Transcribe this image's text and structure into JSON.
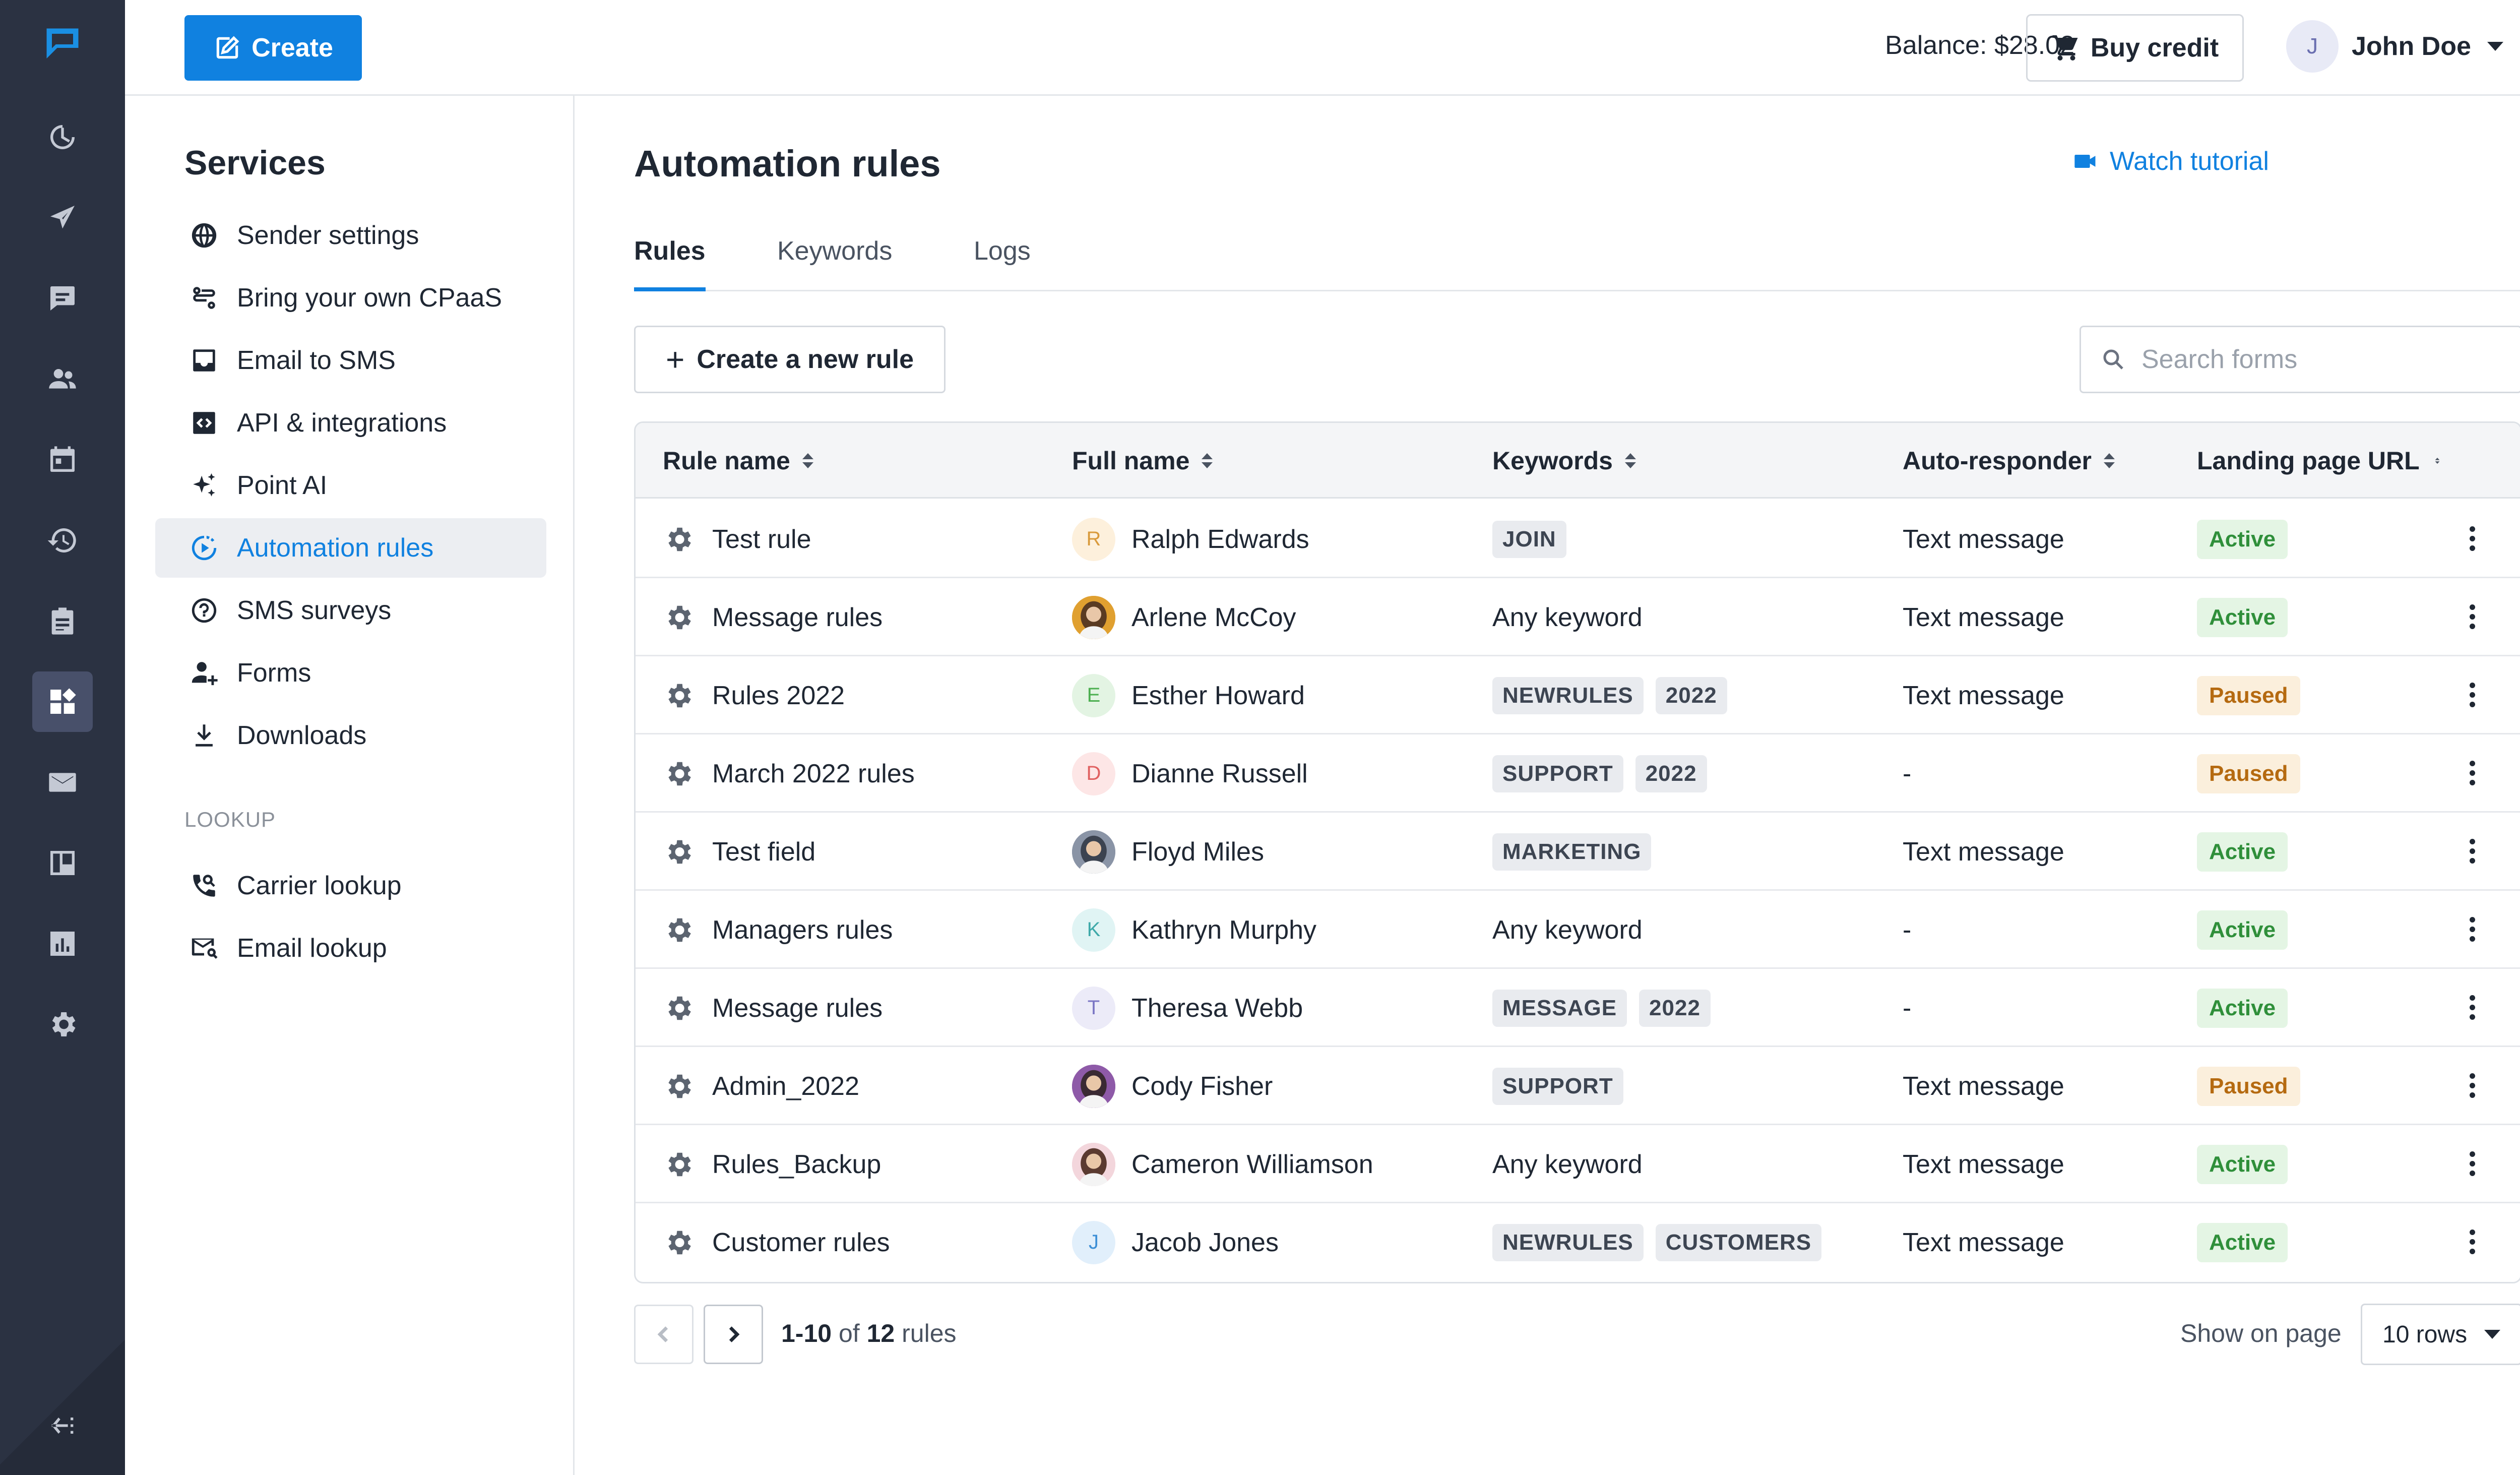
{
  "topbar": {
    "create_label": "Create",
    "balance": "Balance: $28.02",
    "buy_credit_label": "Buy credit",
    "user_initial": "J",
    "user_name": "John Doe"
  },
  "rail": {
    "icons": [
      "logo-icon",
      "dashboard-icon",
      "send-icon",
      "chat-icon",
      "contacts-icon",
      "calendar-icon",
      "history-icon",
      "clipboard-icon",
      "services-icon",
      "mail-icon",
      "board-icon",
      "analytics-icon",
      "settings-icon",
      "collapse-icon"
    ],
    "active": "services-icon"
  },
  "services": {
    "title": "Services",
    "items": [
      {
        "label": "Sender settings",
        "icon": "globe-icon"
      },
      {
        "label": "Bring your own CPaaS",
        "icon": "route-icon"
      },
      {
        "label": "Email to SMS",
        "icon": "inbox-icon"
      },
      {
        "label": "API & integrations",
        "icon": "code-icon"
      },
      {
        "label": "Point AI",
        "icon": "sparkle-icon"
      },
      {
        "label": "Automation rules",
        "icon": "automation-icon",
        "active": true
      },
      {
        "label": "SMS surveys",
        "icon": "question-icon"
      },
      {
        "label": "Forms",
        "icon": "person-add-icon"
      },
      {
        "label": "Downloads",
        "icon": "download-icon"
      }
    ],
    "lookup_heading": "LOOKUP",
    "lookup_items": [
      {
        "label": "Carrier lookup",
        "icon": "phone-search-icon"
      },
      {
        "label": "Email lookup",
        "icon": "mail-search-icon"
      }
    ]
  },
  "main": {
    "title": "Automation rules",
    "watch_tutorial": "Watch tutorial",
    "tabs": [
      {
        "label": "Rules",
        "active": true
      },
      {
        "label": "Keywords"
      },
      {
        "label": "Logs"
      }
    ],
    "create_rule_label": "Create a new rule",
    "search_placeholder": "Search forms"
  },
  "table": {
    "columns": [
      "Rule name",
      "Full name",
      "Keywords",
      "Auto-responder",
      "Landing page URL"
    ],
    "rows": [
      {
        "rule": "Test rule",
        "name": "Ralph Edwards",
        "avatar": {
          "initial": "R",
          "bg": "#fdf0dc",
          "fg": "#d99a3c"
        },
        "keywords": [
          "JOIN"
        ],
        "any_keyword": "",
        "responder": "Text message",
        "status": "Active"
      },
      {
        "rule": "Message rules",
        "name": "Arlene McCoy",
        "avatar": {
          "photo": true,
          "bg": "#e0a030",
          "fg": "#5a3b22"
        },
        "keywords": [],
        "any_keyword": "Any keyword",
        "responder": "Text message",
        "status": "Active"
      },
      {
        "rule": "Rules 2022",
        "name": "Esther Howard",
        "avatar": {
          "initial": "E",
          "bg": "#e3f4e3",
          "fg": "#4caf50"
        },
        "keywords": [
          "NEWRULES",
          "2022"
        ],
        "any_keyword": "",
        "responder": "Text message",
        "status": "Paused"
      },
      {
        "rule": "March 2022 rules",
        "name": "Dianne Russell",
        "avatar": {
          "initial": "D",
          "bg": "#fde6e6",
          "fg": "#e06060"
        },
        "keywords": [
          "SUPPORT",
          "2022"
        ],
        "any_keyword": "",
        "responder": "-",
        "status": "Paused"
      },
      {
        "rule": "Test field",
        "name": "Floyd Miles",
        "avatar": {
          "photo": true,
          "bg": "#8a94a6",
          "fg": "#3c4350"
        },
        "keywords": [
          "MARKETING"
        ],
        "any_keyword": "",
        "responder": "Text message",
        "status": "Active"
      },
      {
        "rule": "Managers rules",
        "name": "Kathryn Murphy",
        "avatar": {
          "initial": "K",
          "bg": "#e0f4f4",
          "fg": "#3fa9a9"
        },
        "keywords": [],
        "any_keyword": "Any keyword",
        "responder": "-",
        "status": "Active"
      },
      {
        "rule": "Message rules",
        "name": "Theresa Webb",
        "avatar": {
          "initial": "T",
          "bg": "#ecebf8",
          "fg": "#7b76c4"
        },
        "keywords": [
          "MESSAGE",
          "2022"
        ],
        "any_keyword": "",
        "responder": "-",
        "status": "Active"
      },
      {
        "rule": "Admin_2022",
        "name": "Cody Fisher",
        "avatar": {
          "photo": true,
          "bg": "#8e5aa8",
          "fg": "#3a2a33"
        },
        "keywords": [
          "SUPPORT"
        ],
        "any_keyword": "",
        "responder": "Text message",
        "status": "Paused"
      },
      {
        "rule": "Rules_Backup",
        "name": "Cameron Williamson",
        "avatar": {
          "photo": true,
          "bg": "#f3d6dc",
          "fg": "#5b3a30"
        },
        "keywords": [],
        "any_keyword": "Any keyword",
        "responder": "Text message",
        "status": "Active"
      },
      {
        "rule": "Customer rules",
        "name": "Jacob Jones",
        "avatar": {
          "initial": "J",
          "bg": "#e1effb",
          "fg": "#3d8fd6"
        },
        "keywords": [
          "NEWRULES",
          "CUSTOMERS"
        ],
        "any_keyword": "",
        "responder": "Text message",
        "status": "Active"
      }
    ]
  },
  "pagination": {
    "range": "1-10",
    "of": "of",
    "total": "12",
    "unit": "rules",
    "show_label": "Show on page",
    "rows_value": "10 rows"
  },
  "colors": {
    "accent": "#1081e0",
    "rail_bg": "#2b3242",
    "active_status": "#2f8f3a",
    "paused_status": "#b56a10"
  }
}
